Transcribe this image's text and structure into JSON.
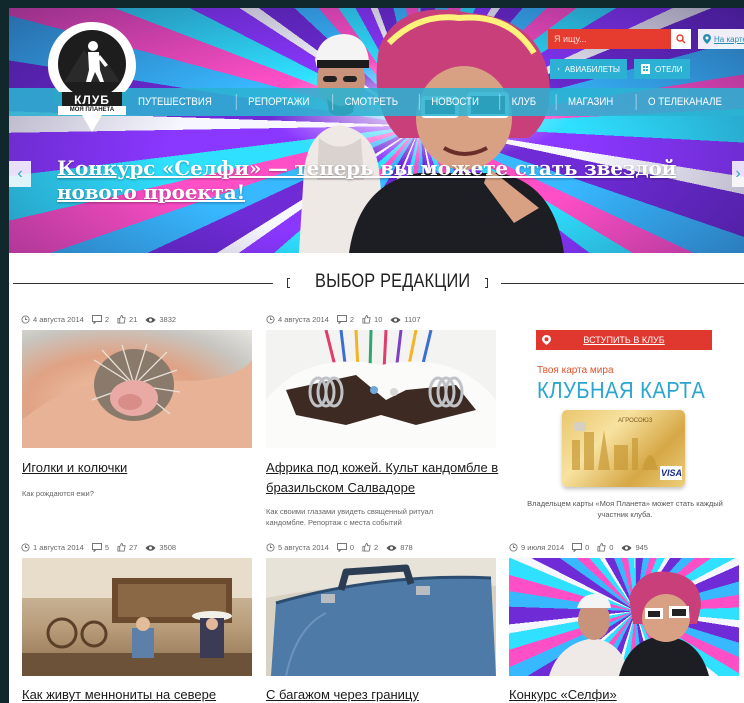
{
  "header": {
    "logo_title": "КЛУБ",
    "logo_subtitle": "МОЯ ПЛАНЕТА",
    "search_placeholder": "Я ищу...",
    "map_link": "На карте",
    "avia_label": "АВИАБИЛЕТЫ",
    "hotels_label": "ОТЕЛИ",
    "nav": [
      "ПУТЕШЕСТВИЯ",
      "РЕПОРТАЖИ",
      "СМОТРЕТЬ",
      "НОВОСТИ",
      "КЛУБ",
      "МАГАЗИН",
      "О ТЕЛЕКАНАЛЕ"
    ]
  },
  "hero": {
    "title": "Конкурс «Селфи» — теперь вы можете стать звездой нового проекта!",
    "prev_arrow": "‹",
    "next_arrow": "›"
  },
  "section": {
    "title": "ВЫБОР РЕДАКЦИИ"
  },
  "articles": [
    {
      "date": "4 августа 2014",
      "comments": "2",
      "likes": "21",
      "views": "3832",
      "title": "Иголки и колючки",
      "desc": "Как рождаются ежи?"
    },
    {
      "date": "4 августа 2014",
      "comments": "2",
      "likes": "10",
      "views": "1107",
      "title": "Африка под кожей. Культ кандомбле в бразильском Салвадоре",
      "desc": "Как своими глазами увидеть священный ритуал кандомбле. Репортаж с места событий"
    },
    {
      "date": "1 августа 2014",
      "comments": "5",
      "likes": "27",
      "views": "3508",
      "title": "Как живут меннониты на севере",
      "desc": ""
    },
    {
      "date": "5 августа 2014",
      "comments": "0",
      "likes": "2",
      "views": "878",
      "title": "С багажом через границу",
      "desc": ""
    },
    {
      "date": "9 июля 2014",
      "comments": "0",
      "likes": "0",
      "views": "945",
      "title": "Конкурс «Селфи»",
      "desc": ""
    }
  ],
  "club": {
    "join_label": "ВСТУПИТЬ В КЛУБ",
    "subtitle": "Твоя карта мира",
    "title": "КЛУБНАЯ КАРТА",
    "card_brand": "АГРОСОЮЗ",
    "card_visa": "VISA",
    "note": "Владельцем карты «Моя Планета» может стать каждый участник клуба."
  }
}
